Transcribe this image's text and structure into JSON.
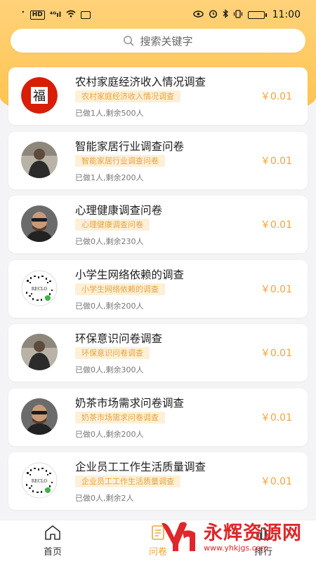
{
  "status_bar": {
    "dot": "·",
    "hd": "HD",
    "signal": "⁴ᴳıl",
    "time": "11:00",
    "battery_level": "▭"
  },
  "search": {
    "placeholder": "搜索关键字",
    "icon": "search-icon"
  },
  "colors": {
    "accent": "#f0a43a",
    "header": "#ffc24a",
    "tag_bg": "#fdf0d8"
  },
  "surveys": [
    {
      "title": "农村家庭经济收入情况调查",
      "tag": "农村家庭经济收入情况调查",
      "meta": "已做1人,剩余500人",
      "price": "￥0.01",
      "avatar": "fu-avatar"
    },
    {
      "title": "智能家居行业调查问卷",
      "tag": "智能家居行业调查问卷",
      "meta": "已做1人,剩余200人",
      "price": "￥0.01",
      "avatar": "person-avatar"
    },
    {
      "title": "心理健康调查问卷",
      "tag": "心理健康调查问卷",
      "meta": "已做0人,剩余230人",
      "price": "￥0.01",
      "avatar": "man-avatar"
    },
    {
      "title": "小学生网络依赖的调查",
      "tag": "小学生网络依赖的调查",
      "meta": "已做0人,剩余200人",
      "price": "￥0.01",
      "avatar": "qr-avatar"
    },
    {
      "title": "环保意识问卷调查",
      "tag": "环保意识问卷调查",
      "meta": "已做0人,剩余300人",
      "price": "￥0.01",
      "avatar": "person-avatar"
    },
    {
      "title": "奶茶市场需求问卷调查",
      "tag": "奶茶市场需求问卷调查",
      "meta": "已做0人,剩余200人",
      "price": "￥0.01",
      "avatar": "man-avatar"
    },
    {
      "title": "企业员工工作生活质量调查",
      "tag": "企业员工工作生活质量调查",
      "meta": "已做0人,剩余2人",
      "price": "￥0.01",
      "avatar": "qr-avatar"
    }
  ],
  "fu_char": "福",
  "qr_label": "RECLO",
  "tabs": [
    {
      "label": "首页",
      "icon": "home-icon"
    },
    {
      "label": "问卷",
      "icon": "survey-icon"
    },
    {
      "label": "排行",
      "icon": "rank-icon"
    }
  ],
  "watermark": {
    "title": "永辉资源网",
    "url": "www.yhkjgs.com"
  }
}
